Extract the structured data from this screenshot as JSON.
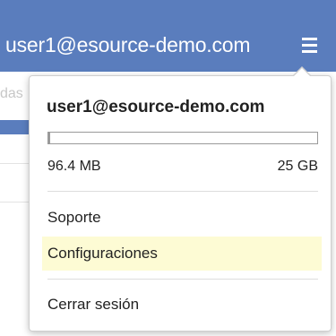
{
  "header": {
    "user_email": "user1@esource-demo.com",
    "background_color": "#5a7dbd",
    "menu_icon": "hamburger-menu-icon"
  },
  "background_page": {
    "partial_text": "das"
  },
  "dropdown": {
    "user_email": "user1@esource-demo.com",
    "storage": {
      "used_label": "96.4 MB",
      "total_label": "25 GB",
      "used_fraction": 0.0038
    },
    "items": [
      {
        "label": "Soporte"
      },
      {
        "label": "Configuraciones",
        "highlighted": true
      },
      {
        "label": "Cerrar sesión"
      }
    ],
    "highlight_color": "#fdfbd4"
  }
}
